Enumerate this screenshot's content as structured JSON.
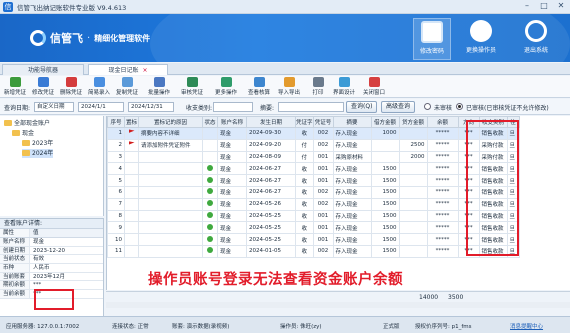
{
  "app": {
    "title": "信管飞出纳记账软件专业版  V9.4.613",
    "logo_name": "信管飞",
    "logo_sub": "精细化管理软件",
    "logo_dot": "·"
  },
  "banner_buttons": [
    {
      "label": "修改密码",
      "icon": "key-icon"
    },
    {
      "label": "更换操作员",
      "icon": "user-switch-icon"
    },
    {
      "label": "退出系统",
      "icon": "power-icon"
    }
  ],
  "tabs": [
    {
      "label": "功能导航器"
    },
    {
      "label": "现金日记账",
      "close": "×"
    }
  ],
  "toolbar": [
    "新增凭证",
    "修改凭证",
    "删除凭证",
    "简易录入",
    "复制凭证",
    "批量操作",
    "审核凭证",
    "更多操作",
    "查看核算",
    "导入导出",
    "打印",
    "界面设计",
    "关闭窗口"
  ],
  "filter": {
    "date_label": "查询日期:",
    "date_mode": "自定义日期",
    "date_from": "2024/1/1",
    "date_to": "2024/12/31",
    "category_label": "收支类别:",
    "summary_label": "摘要:",
    "query_btn": "查询(Q)",
    "advanced_btn": "高级查询",
    "opt_unaudited": "未审核",
    "opt_audited": "已审核(已审核凭证不允许修改)"
  },
  "tree": {
    "root": "全部现金账户",
    "account": "现金",
    "years": [
      "2023年",
      "2024年"
    ]
  },
  "detail": {
    "title": "查看账户详情:",
    "col_attr": "属性",
    "col_val": "值",
    "rows": [
      {
        "k": "账户名称",
        "v": "现金"
      },
      {
        "k": "创建日期",
        "v": "2023-12-20"
      },
      {
        "k": "当前状态",
        "v": "有效"
      },
      {
        "k": "币种",
        "v": "人民币"
      },
      {
        "k": "当前账套",
        "v": "2023年12月"
      },
      {
        "k": "期初余额",
        "v": "***"
      },
      {
        "k": "当前余额",
        "v": "***"
      }
    ]
  },
  "grid": {
    "columns": [
      "序号",
      "置标",
      "置标记的原因",
      "状态",
      "账户名称",
      "发生日期",
      "凭证字",
      "凭证号",
      "摘要",
      "借方金额",
      "贷方金额",
      "余额",
      "方向",
      "收支类别",
      "往"
    ],
    "rows": [
      {
        "no": "1",
        "flag": true,
        "reason": "摘要内容不详细",
        "status": "",
        "acct": "现金",
        "date": "2024-09-30",
        "word": "收",
        "vno": "002",
        "summary": "存入现金",
        "debit": "1000",
        "credit": "",
        "bal": "*****",
        "dir": "***",
        "cat": "销售收款",
        "other": "旦"
      },
      {
        "no": "2",
        "flag": true,
        "reason": "请添加附件凭证附件",
        "status": "",
        "acct": "现金",
        "date": "2024-09-20",
        "word": "付",
        "vno": "002",
        "summary": "存入现金",
        "debit": "",
        "credit": "2500",
        "bal": "*****",
        "dir": "***",
        "cat": "采购付款",
        "other": "旦"
      },
      {
        "no": "3",
        "flag": false,
        "reason": "",
        "status": "",
        "acct": "现金",
        "date": "2024-08-09",
        "word": "付",
        "vno": "001",
        "summary": "采购原材料",
        "debit": "",
        "credit": "2000",
        "bal": "*****",
        "dir": "***",
        "cat": "采购付款",
        "other": "旦"
      },
      {
        "no": "4",
        "flag": false,
        "reason": "",
        "status": "dot",
        "acct": "现金",
        "date": "2024-06-27",
        "word": "收",
        "vno": "001",
        "summary": "存入现金",
        "debit": "1500",
        "credit": "",
        "bal": "*****",
        "dir": "***",
        "cat": "销售收款",
        "other": "旦"
      },
      {
        "no": "5",
        "flag": false,
        "reason": "",
        "status": "dot",
        "acct": "现金",
        "date": "2024-06-27",
        "word": "收",
        "vno": "001",
        "summary": "存入现金",
        "debit": "1500",
        "credit": "",
        "bal": "*****",
        "dir": "***",
        "cat": "销售收款",
        "other": "旦"
      },
      {
        "no": "6",
        "flag": false,
        "reason": "",
        "status": "dot",
        "acct": "现金",
        "date": "2024-06-27",
        "word": "收",
        "vno": "002",
        "summary": "存入现金",
        "debit": "1500",
        "credit": "",
        "bal": "*****",
        "dir": "***",
        "cat": "销售收款",
        "other": "旦"
      },
      {
        "no": "7",
        "flag": false,
        "reason": "",
        "status": "dot",
        "acct": "现金",
        "date": "2024-05-26",
        "word": "收",
        "vno": "002",
        "summary": "存入现金",
        "debit": "1500",
        "credit": "",
        "bal": "*****",
        "dir": "***",
        "cat": "销售收款",
        "other": "旦"
      },
      {
        "no": "8",
        "flag": false,
        "reason": "",
        "status": "dot",
        "acct": "现金",
        "date": "2024-05-25",
        "word": "收",
        "vno": "001",
        "summary": "存入现金",
        "debit": "1500",
        "credit": "",
        "bal": "*****",
        "dir": "***",
        "cat": "销售收款",
        "other": "旦"
      },
      {
        "no": "9",
        "flag": false,
        "reason": "",
        "status": "dot",
        "acct": "现金",
        "date": "2024-05-25",
        "word": "收",
        "vno": "001",
        "summary": "存入现金",
        "debit": "1500",
        "credit": "",
        "bal": "*****",
        "dir": "***",
        "cat": "销售收款",
        "other": "旦"
      },
      {
        "no": "10",
        "flag": false,
        "reason": "",
        "status": "dot",
        "acct": "现金",
        "date": "2024-05-25",
        "word": "收",
        "vno": "001",
        "summary": "存入现金",
        "debit": "1500",
        "credit": "",
        "bal": "*****",
        "dir": "***",
        "cat": "销售收款",
        "other": "旦"
      },
      {
        "no": "11",
        "flag": false,
        "reason": "",
        "status": "dot",
        "acct": "现金",
        "date": "2024-01-05",
        "word": "收",
        "vno": "002",
        "summary": "存入现金",
        "debit": "1500",
        "credit": "",
        "bal": "*****",
        "dir": "***",
        "cat": "销售收款",
        "other": "旦"
      }
    ],
    "total_debit": "14000",
    "total_credit": "3500"
  },
  "overlay_text": "操作员账号登录无法查看资金账户余额",
  "statusbar": {
    "server": "应用服务器: 127.0.0.1:7002",
    "connect": "连接状态: 正常",
    "account": "账套: 演示数据(录视频)",
    "operator": "操作员: 侏旺(zy)",
    "edition": "正式版",
    "license": "授权价序列号: p1_fms",
    "msg": "消息提醒中心"
  },
  "colors": {
    "accent": "#1d72d6",
    "highlight": "#e21c2a"
  }
}
